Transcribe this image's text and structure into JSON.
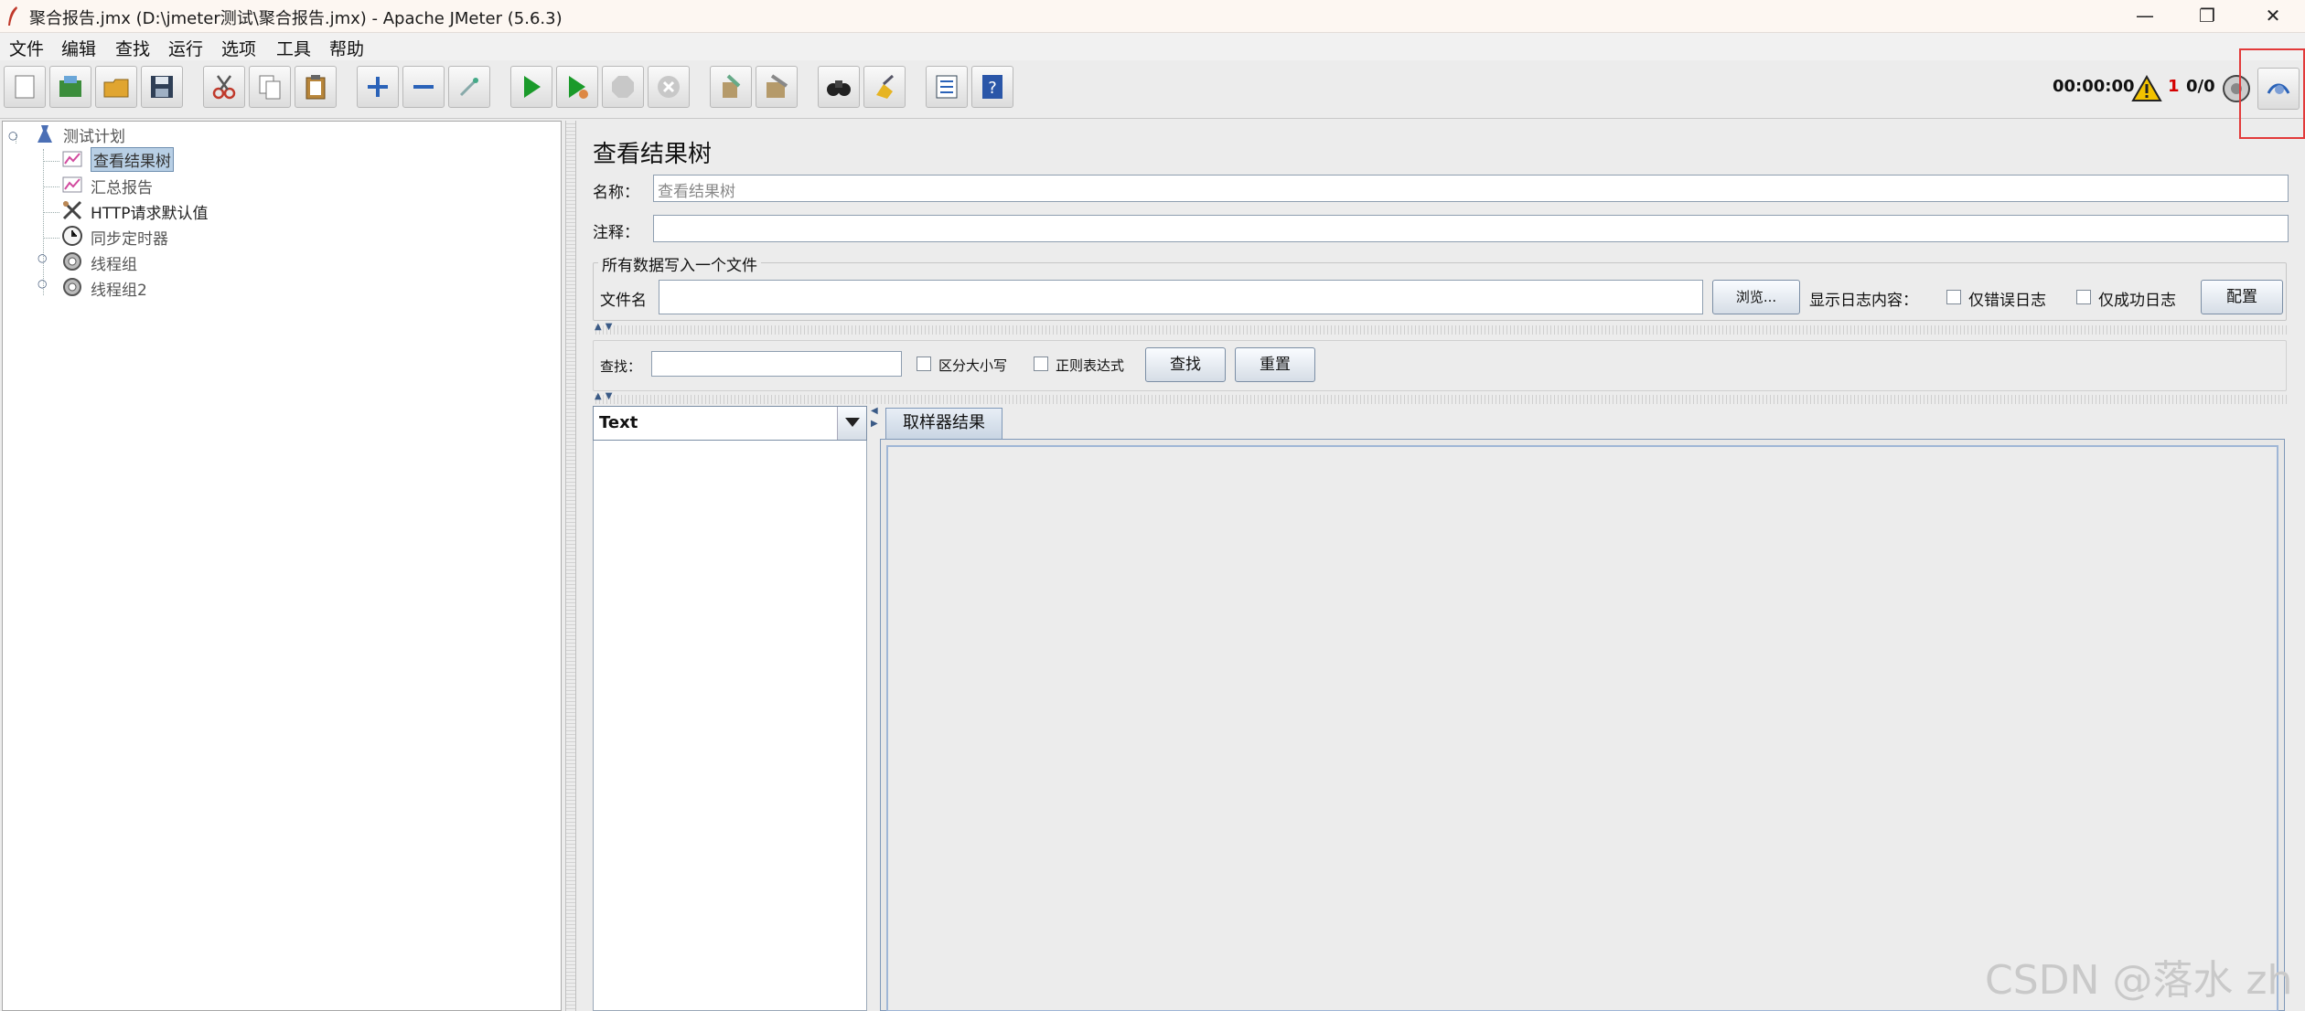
{
  "window": {
    "title": "聚合报告.jmx (D:\\jmeter测试\\聚合报告.jmx) - Apache JMeter (5.6.3)",
    "minimize": "—",
    "restore": "❐",
    "close": "✕"
  },
  "menu": [
    "文件",
    "编辑",
    "查找",
    "运行",
    "选项",
    "工具",
    "帮助"
  ],
  "toolbar": {
    "buttons": [
      "new-icon",
      "templates-icon",
      "open-icon",
      "save-icon",
      "cut-icon",
      "copy-icon",
      "paste-icon",
      "expand-icon",
      "collapse-icon",
      "toggle-icon",
      "start-icon",
      "start-no-pause-icon",
      "stop-icon",
      "shutdown-icon",
      "clear-icon",
      "clear-all-icon",
      "search-icon",
      "reset-search-icon",
      "function-helper-icon",
      "help-icon"
    ],
    "timer": "00:00:00",
    "warning_count": "1",
    "threads": "0/0"
  },
  "tree": {
    "items": [
      {
        "label": "测试计划",
        "icon": "test-plan-icon"
      },
      {
        "label": "查看结果树",
        "icon": "listener-icon",
        "selected": true
      },
      {
        "label": "汇总报告",
        "icon": "listener-icon"
      },
      {
        "label": "HTTP请求默认值",
        "icon": "config-tools-icon"
      },
      {
        "label": "同步定时器",
        "icon": "timer-icon"
      },
      {
        "label": "线程组",
        "icon": "thread-group-icon"
      },
      {
        "label": "线程组2",
        "icon": "thread-group-icon"
      }
    ]
  },
  "panel": {
    "title": "查看结果树",
    "name_label": "名称：",
    "name_value": "查看结果树",
    "comment_label": "注释：",
    "comment_value": "",
    "file_group_title": "所有数据写入一个文件",
    "filename_label": "文件名",
    "filename_value": "",
    "browse_button": "浏览...",
    "log_content_label": "显示日志内容：",
    "errors_only": "仅错误日志",
    "success_only": "仅成功日志",
    "configure_button": "配置",
    "search_label": "查找：",
    "search_value": "",
    "case_sensitive": "区分大小写",
    "regex": "正则表达式",
    "find_button": "查找",
    "reset_button": "重置",
    "renderer_value": "Text",
    "result_tab": "取样器结果"
  },
  "colors": {
    "selection": "#b8cfe5",
    "highlight_box": "#e23a3a",
    "start_green": "#1a9a2a"
  },
  "watermark": "CSDN @落水 zh"
}
